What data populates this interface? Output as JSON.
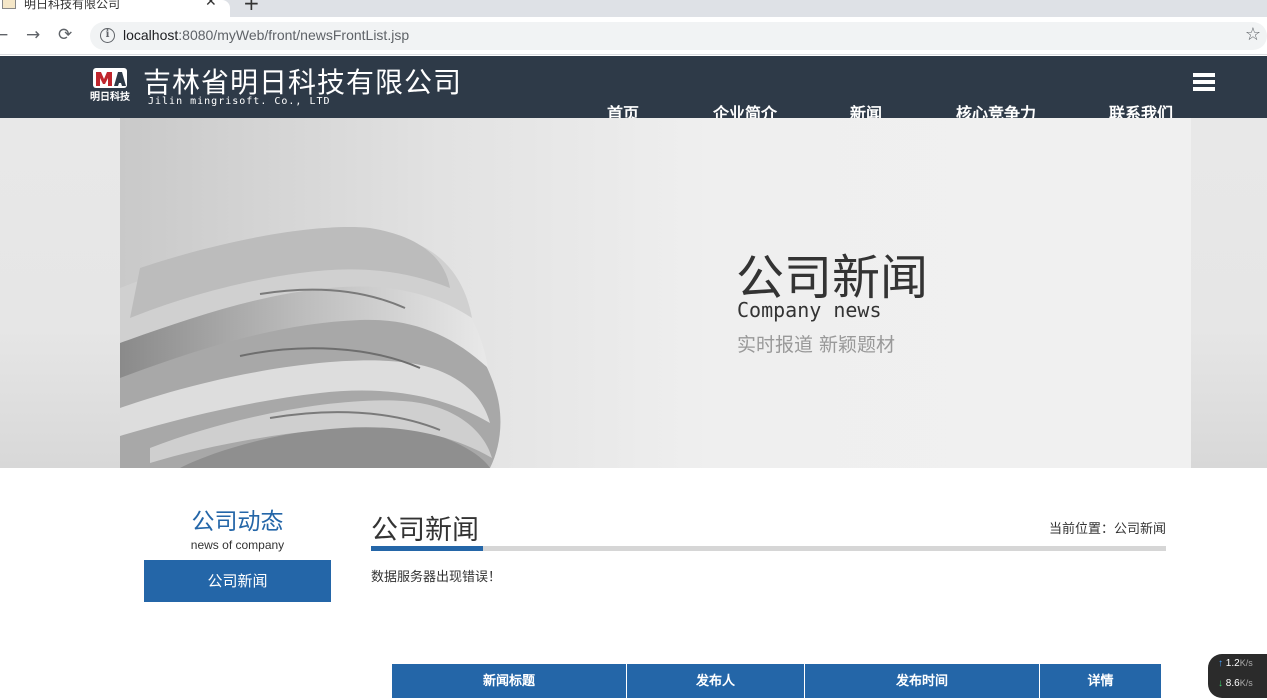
{
  "browser": {
    "tab_title": "明日科技有限公司",
    "tab_close": "✕",
    "new_tab": "+",
    "back": "←",
    "forward": "→",
    "reload": "⟳",
    "url_host": "localhost",
    "url_path": ":8080/myWeb/front/newsFrontList.jsp",
    "info_glyph": "i",
    "bookmark_star": "☆"
  },
  "header": {
    "company_name": "吉林省明日科技有限公司",
    "company_en": "Jilin mingrisoft. Co., LTD",
    "logo_text": "明日科技",
    "nav": [
      "首页",
      "企业简介",
      "新闻",
      "核心竞争力",
      "联系我们"
    ]
  },
  "banner": {
    "title": "公司新闻",
    "subtitle_en": "Company news",
    "tagline": "实时报道  新颖题材"
  },
  "sidebar": {
    "title": "公司动态",
    "subtitle": "news of company",
    "items": [
      "公司新闻"
    ]
  },
  "main": {
    "title": "公司新闻",
    "breadcrumb": "当前位置：公司新闻",
    "error": "数据服务器出现错误！",
    "table_headers": [
      "新闻标题",
      "发布人",
      "发布时间",
      "详情"
    ]
  },
  "netspeed": {
    "up_value": "1.2",
    "up_unit": "K/s",
    "down_value": "8.6",
    "down_unit": "K/s"
  },
  "colors": {
    "header_bg": "#2e3a48",
    "accent_blue": "#2466a8"
  }
}
